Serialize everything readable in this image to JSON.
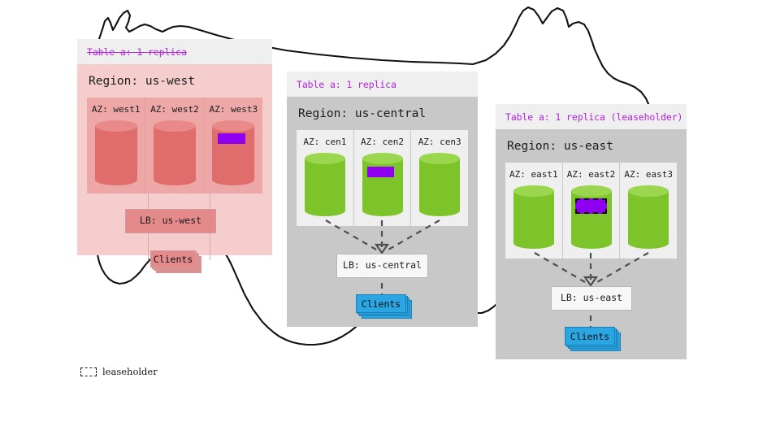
{
  "legend": {
    "swatch_icon": "dashed-rectangle-icon",
    "label": "leaseholder"
  },
  "regions": [
    {
      "id": "us-west",
      "status": "offline",
      "table_banner": "Table a: 1 replica",
      "banner_struck": true,
      "title": "Region: us-west",
      "azs": [
        {
          "label": "AZ: west1",
          "replica": false,
          "leaseholder": false
        },
        {
          "label": "AZ: west2",
          "replica": false,
          "leaseholder": false
        },
        {
          "label": "AZ: west3",
          "replica": true,
          "leaseholder": false
        }
      ],
      "lb_label": "LB: us-west",
      "clients_label": "Clients"
    },
    {
      "id": "us-central",
      "status": "online",
      "table_banner": "Table a: 1 replica",
      "banner_struck": false,
      "title": "Region: us-central",
      "azs": [
        {
          "label": "AZ: cen1",
          "replica": false,
          "leaseholder": false
        },
        {
          "label": "AZ: cen2",
          "replica": true,
          "leaseholder": false
        },
        {
          "label": "AZ: cen3",
          "replica": false,
          "leaseholder": false
        }
      ],
      "lb_label": "LB: us-central",
      "clients_label": "Clients"
    },
    {
      "id": "us-east",
      "status": "online",
      "table_banner": "Table a: 1 replica (leaseholder)",
      "banner_struck": false,
      "title": "Region: us-east",
      "azs": [
        {
          "label": "AZ: east1",
          "replica": false,
          "leaseholder": false
        },
        {
          "label": "AZ: east2",
          "replica": true,
          "leaseholder": true
        },
        {
          "label": "AZ: east3",
          "replica": false,
          "leaseholder": false
        }
      ],
      "lb_label": "LB: us-east",
      "clients_label": "Clients"
    }
  ],
  "colors": {
    "replica_purple": "#8f00f0",
    "banner_text": "#b026d9",
    "db_green": "#7dc42a",
    "db_green_light": "#9ad64e",
    "db_red": "#e06c6c",
    "db_red_light": "#ea8989",
    "clients_blue": "#2ca5e3",
    "region_gray": "#c8c8c8",
    "region_pink": "#f6cdcd",
    "header_gray": "#efefef",
    "map_stroke": "#111111"
  },
  "map": {
    "name": "united-states-outline"
  }
}
